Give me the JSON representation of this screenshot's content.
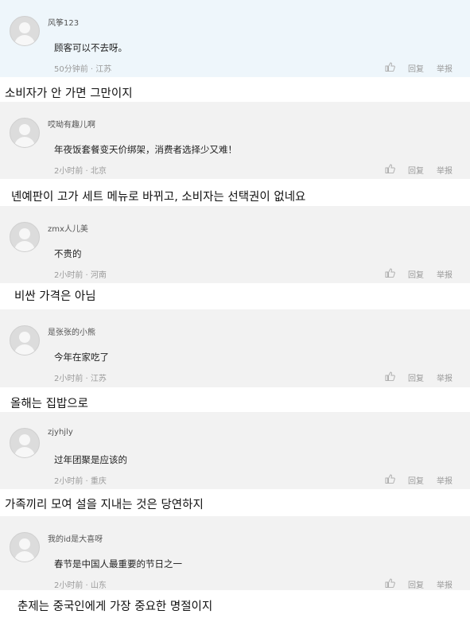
{
  "actions": {
    "reply": "回复",
    "report": "举报"
  },
  "comments": [
    {
      "user": "风筝123",
      "text": "顾客可以不去呀。",
      "meta": "50分钟前 · 江苏"
    },
    {
      "user": "哎呦有趣儿啊",
      "text": "年夜饭套餐变天价绑架，消费者选择少又难！",
      "meta": "2小时前 · 北京"
    },
    {
      "user": "zmx人儿美",
      "text": "不贵的",
      "meta": "2小时前 · 河南"
    },
    {
      "user": "是张张的小熊",
      "text": "今年在家吃了",
      "meta": "2小时前 · 江苏"
    },
    {
      "user": "zjyhjly",
      "text": "过年团聚是应该的",
      "meta": "2小时前 · 重庆"
    },
    {
      "user": "我的id是大喜呀",
      "text": "春节是中国人最重要的节日之一",
      "meta": "2小时前 · 山东"
    }
  ],
  "translations": [
    "소비자가 안 가면 그만이지",
    "녠예판이 고가 세트 메뉴로 바뀌고, 소비자는 선택권이 없네요",
    "비싼 가격은 아님",
    "올해는 집밥으로",
    "가족끼리 모여 설을 지내는 것은 당연하지",
    "춘제는 중국인에게 가장 중요한 명절이지"
  ]
}
